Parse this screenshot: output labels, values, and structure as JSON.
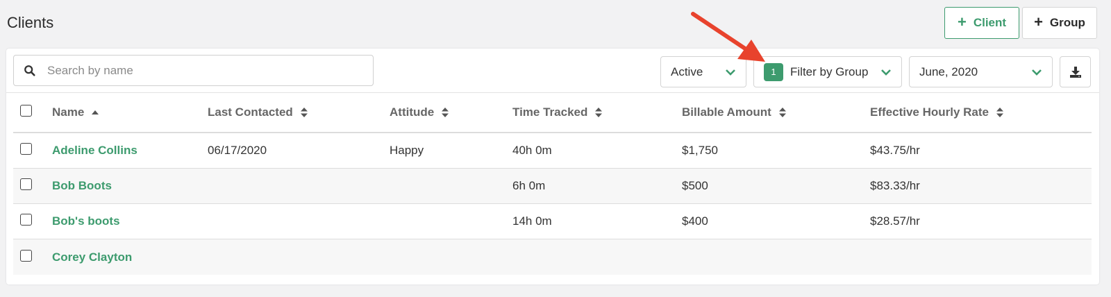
{
  "page": {
    "title": "Clients"
  },
  "actions": {
    "client_label": "Client",
    "group_label": "Group"
  },
  "toolbar": {
    "search_placeholder": "Search by name",
    "status_filter": "Active",
    "group_filter": {
      "count": "1",
      "label": "Filter by Group"
    },
    "month_filter": "June, 2020",
    "download_icon": "download-icon"
  },
  "table": {
    "columns": [
      "Name",
      "Last Contacted",
      "Attitude",
      "Time Tracked",
      "Billable Amount",
      "Effective Hourly Rate"
    ],
    "rows": [
      {
        "name": "Adeline Collins",
        "last_contacted": "06/17/2020",
        "attitude": "Happy",
        "time_tracked": "40h 0m",
        "billable": "$1,750",
        "rate": "$43.75/hr"
      },
      {
        "name": "Bob Boots",
        "last_contacted": "",
        "attitude": "",
        "time_tracked": "6h 0m",
        "billable": "$500",
        "rate": "$83.33/hr"
      },
      {
        "name": "Bob's boots",
        "last_contacted": "",
        "attitude": "",
        "time_tracked": "14h 0m",
        "billable": "$400",
        "rate": "$28.57/hr"
      },
      {
        "name": "Corey Clayton",
        "last_contacted": "",
        "attitude": "",
        "time_tracked": "",
        "billable": "",
        "rate": ""
      }
    ]
  },
  "colors": {
    "accent": "#3d9b6e",
    "annotation_arrow": "#e8432d"
  }
}
